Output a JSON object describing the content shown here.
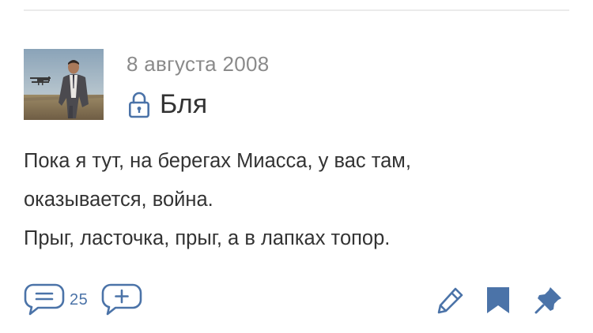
{
  "post": {
    "date": "8 августа 2008",
    "title": "Бля",
    "body_lines": [
      "Пока я тут, на берегах Миасса, у вас там,",
      "оказывается, война.",
      "Прыг, ласточка, прыг, а в лапках топор."
    ]
  },
  "actions": {
    "comments_count": "25"
  },
  "icons": {
    "lock": "lock-icon",
    "comments": "speech-bubble-icon",
    "add_comment": "add-comment-icon",
    "edit": "pencil-icon",
    "bookmark": "bookmark-icon",
    "pin": "pin-icon"
  },
  "colors": {
    "accent": "#4b73a8",
    "text": "#333333",
    "muted": "#8a8a8a",
    "divider": "#ebebeb"
  }
}
